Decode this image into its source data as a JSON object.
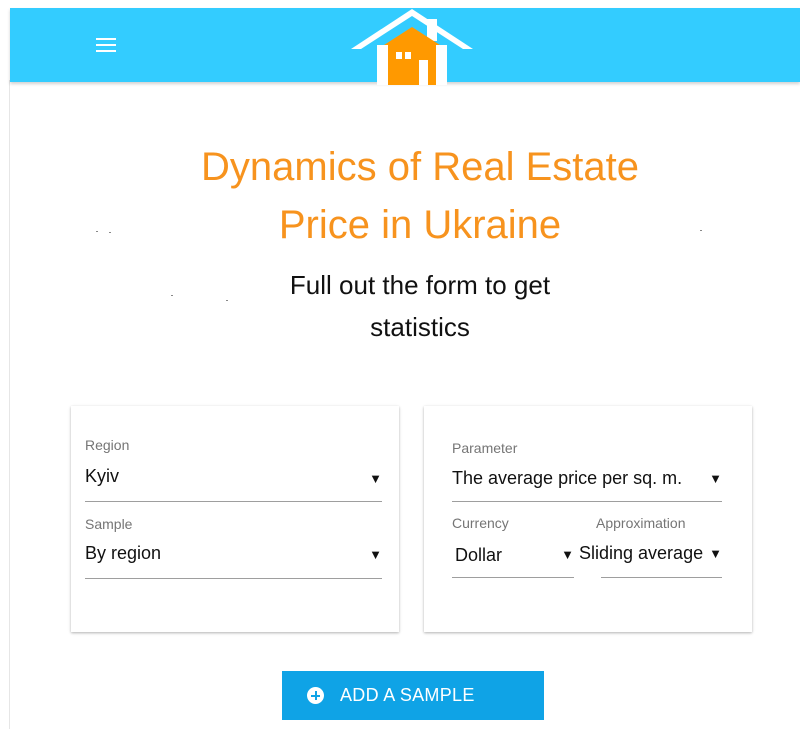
{
  "header": {
    "menu_icon": "hamburger-menu-icon",
    "logo_icon": "house-icon",
    "brand_color": "#33ccff",
    "logo_color": "#ff9900"
  },
  "main": {
    "title_line1": "Dynamics of Real Estate",
    "title_line2": "Price in Ukraine",
    "title_color": "#f7931e",
    "subtitle_line1": "Full out the form to get",
    "subtitle_line2": "statistics"
  },
  "form_left": {
    "region": {
      "label": "Region",
      "value": "Kyiv"
    },
    "sample": {
      "label": "Sample",
      "value": "By region"
    }
  },
  "form_right": {
    "parameter": {
      "label": "Parameter",
      "value": "The average price per sq. m."
    },
    "currency": {
      "label": "Currency",
      "value": "Dollar"
    },
    "approximation": {
      "label": "Approximation",
      "value": "Sliding average"
    }
  },
  "dropdown_arrow": "▼",
  "add_button": {
    "label": "ADD A SAMPLE",
    "icon": "plus-circle-icon",
    "color": "#0fa3e6"
  }
}
